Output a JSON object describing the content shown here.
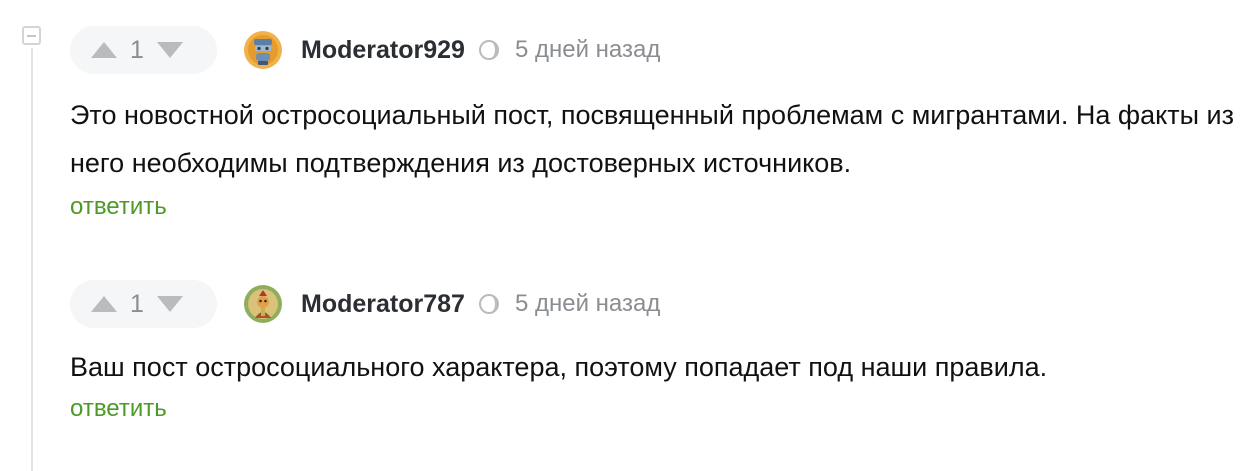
{
  "comments": [
    {
      "votes": "1",
      "username": "Moderator929",
      "time": "5 дней назад",
      "text": "Это новостной остросоциальный пост, посвященный проблемам с мигрантами. На факты из него необходимы подтверждения из достоверных источников.",
      "reply_label": "ответить",
      "avatar_icon": "moderator-avatar-blue"
    },
    {
      "votes": "1",
      "username": "Moderator787",
      "time": "5 дней назад",
      "text": "Ваш пост остросоциального характера, поэтому попадает под наши правила.",
      "reply_label": "ответить",
      "avatar_icon": "moderator-avatar-green"
    }
  ],
  "colors": {
    "reply_link": "#4d9a26",
    "muted_text": "#8a8d91",
    "vote_background": "#f5f6f7",
    "thread_line": "#e3e4e6"
  }
}
